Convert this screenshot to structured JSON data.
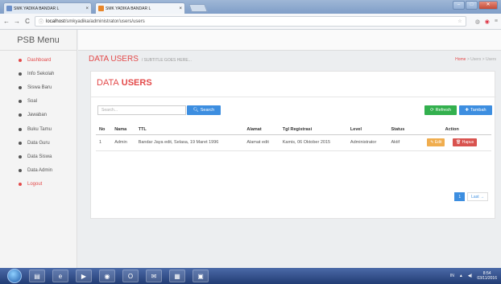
{
  "browser": {
    "tabs": [
      {
        "title": "SMK YADIKA BANDAR L",
        "close": "×"
      },
      {
        "title": "SMK YADIKA BANDAR L",
        "close": "×"
      }
    ],
    "url_host": "localhost",
    "url_path": "/smkyadika/administrator/users/users",
    "back": "←",
    "forward": "→",
    "reload": "C"
  },
  "sidebar": {
    "brand": "PSB Menu",
    "items": [
      {
        "label": "Dashboard"
      },
      {
        "label": "Info Sekolah"
      },
      {
        "label": "Siswa Baru"
      },
      {
        "label": "Soal"
      },
      {
        "label": "Jawaban"
      },
      {
        "label": "Buku Tamu"
      },
      {
        "label": "Data Guru"
      },
      {
        "label": "Data Siswa"
      },
      {
        "label": "Data Admin"
      },
      {
        "label": "Logout"
      }
    ]
  },
  "header": {
    "title": "DATA USERS",
    "subtitle": "/ SUBTITLE GOES HERE...",
    "breadcrumb": {
      "home": "Home",
      "sep": ">",
      "users1": "Users",
      "users2": "Users"
    }
  },
  "card": {
    "title_first": "DATA",
    "title_second": "USERS",
    "search_placeholder": "Search...",
    "search_button": "Search",
    "refresh_button": "Refresh",
    "add_button": "Tambah"
  },
  "table": {
    "headers": [
      "No",
      "Nama",
      "TTL",
      "Alamat",
      "Tgl Registrasi",
      "Level",
      "Status",
      "Action"
    ],
    "rows": [
      {
        "no": "1",
        "nama": "Admin",
        "ttl": "Bandar Jaya edit, Selasa, 19 Maret 1996",
        "alamat": "Alamat edit",
        "tgl": "Kamis, 06 Oktober 2015",
        "level": "Administrator",
        "status": "Aktif",
        "edit": "Edit",
        "hapus": "Hapus"
      }
    ]
  },
  "pager": {
    "current": "1",
    "last": "Last →"
  },
  "taskbar": {
    "lang": "IN",
    "time": "8:54",
    "date": "03/11/2016"
  },
  "colors": {
    "accent": "#e34a4a",
    "primary": "#3d8ee0",
    "success": "#33b04e",
    "warning": "#f0ad4e",
    "danger": "#d9534f"
  }
}
